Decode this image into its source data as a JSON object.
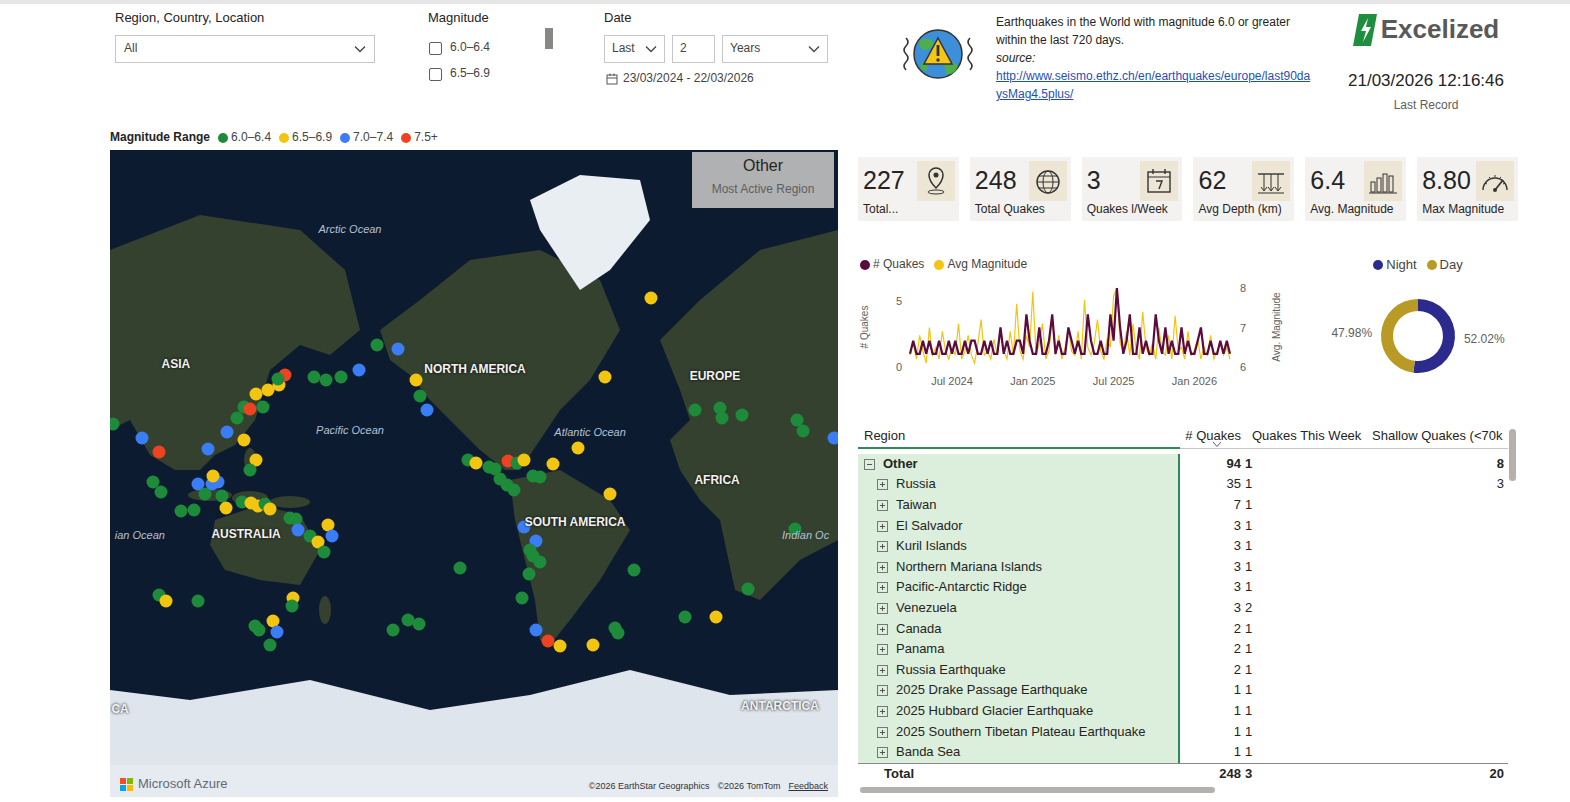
{
  "filters": {
    "region": {
      "label": "Region, Country, Location",
      "value": "All"
    },
    "magnitude": {
      "label": "Magnitude",
      "options": [
        {
          "label": "6.0–6.4",
          "checked": false
        },
        {
          "label": "6.5–6.9",
          "checked": false
        }
      ]
    },
    "date": {
      "label": "Date",
      "mode": "Last",
      "count": "2",
      "unit": "Years",
      "range": "23/03/2024 - 22/03/2026"
    }
  },
  "description": {
    "title": "Earthquakes in the World with magnitude 6.0 or greater within the last 720 days.",
    "source_label": "source:",
    "source_url": "http://www.seismo.ethz.ch/en/earthquakes/europe/last90daysMag4.5plus/"
  },
  "brand": {
    "logo": "Excelized",
    "last_record": "21/03/2026 12:16:46",
    "last_record_label": "Last Record"
  },
  "legend": {
    "title": "Magnitude Range",
    "items": [
      {
        "label": "6.0–6.4",
        "color": "#1e8b3a"
      },
      {
        "label": "6.5–6.9",
        "color": "#f2c511"
      },
      {
        "label": "7.0–7.4",
        "color": "#3b7df5"
      },
      {
        "label": "7.5+",
        "color": "#ee4322"
      }
    ]
  },
  "map": {
    "overlay": {
      "value": "Other",
      "label": "Most Active Region"
    },
    "labels": [
      {
        "text": "Arctic Ocean",
        "lon": 178.7,
        "lat": 79,
        "kind": "ocean"
      },
      {
        "text": "ASIA",
        "lon": 92.6,
        "lat": 55.3,
        "kind": "continent"
      },
      {
        "text": "Pacific Ocean",
        "lon": 178.7,
        "lat": 32.7,
        "kind": "ocean"
      },
      {
        "text": "NORTH AMERICA",
        "lon": -119.5,
        "lat": 53.9,
        "kind": "continent"
      },
      {
        "text": "Atlantic Ocean",
        "lon": -62.6,
        "lat": 31.8,
        "kind": "ocean"
      },
      {
        "text": "EUROPE",
        "lon": -0.8,
        "lat": 51.8,
        "kind": "continent"
      },
      {
        "text": "AFRICA",
        "lon": 0.2,
        "lat": 9.4,
        "kind": "continent"
      },
      {
        "text": "SOUTH AMERICA",
        "lon": -70,
        "lat": -11.3,
        "kind": "continent"
      },
      {
        "text": "AUSTRALIA",
        "lon": 127.3,
        "lat": -17.1,
        "kind": "continent"
      },
      {
        "text": "ian Ocean",
        "lon": 74.8,
        "lat": -17.1,
        "kind": "ocean"
      },
      {
        "text": "Indian Oc",
        "lon": 44,
        "lat": -17.1,
        "kind": "ocean"
      },
      {
        "text": "CA",
        "lon": 65,
        "lat": -71.4,
        "kind": "continent"
      },
      {
        "text": "ANTARCTICA",
        "lon": 31.3,
        "lat": -71,
        "kind": "continent"
      }
    ],
    "pins": [
      {
        "lon": 61.5,
        "lat": 35,
        "color": "#1e8b3a"
      },
      {
        "lon": 76,
        "lat": 29.3,
        "color": "#3b7df5"
      },
      {
        "lon": 84,
        "lat": 23,
        "color": "#ee4322"
      },
      {
        "lon": 81,
        "lat": 8.9,
        "color": "#1e8b3a"
      },
      {
        "lon": 85,
        "lat": 4,
        "color": "#1e8b3a"
      },
      {
        "lon": 95,
        "lat": -5.4,
        "color": "#1e8b3a"
      },
      {
        "lon": 101.5,
        "lat": -5,
        "color": "#1e8b3a"
      },
      {
        "lon": 103.5,
        "lat": 7.9,
        "color": "#3b7df5"
      },
      {
        "lon": 108.5,
        "lat": 24.4,
        "color": "#3b7df5"
      },
      {
        "lon": 110.4,
        "lat": 8,
        "color": "#3b7df5"
      },
      {
        "lon": 113.4,
        "lat": 8.9,
        "color": "#3b7df5"
      },
      {
        "lon": 107,
        "lat": 3,
        "color": "#1e8b3a"
      },
      {
        "lon": 111,
        "lat": 11.8,
        "color": "#f2c511"
      },
      {
        "lon": 115.4,
        "lat": 2,
        "color": "#1e8b3a"
      },
      {
        "lon": 117.4,
        "lat": -4,
        "color": "#f2c511"
      },
      {
        "lon": 125.3,
        "lat": -1,
        "color": "#1e8b3a"
      },
      {
        "lon": 129.7,
        "lat": -1.5,
        "color": "#f2c511"
      },
      {
        "lon": 133,
        "lat": -3,
        "color": "#f2c511"
      },
      {
        "lon": 136.6,
        "lat": -2,
        "color": "#1e8b3a"
      },
      {
        "lon": 139,
        "lat": -4.5,
        "color": "#f2c511"
      },
      {
        "lon": 149,
        "lat": -8.9,
        "color": "#1e8b3a"
      },
      {
        "lon": 152,
        "lat": -9.4,
        "color": "#1e8b3a"
      },
      {
        "lon": 153,
        "lat": -14.7,
        "color": "#3b7df5"
      },
      {
        "lon": 159,
        "lat": -17.6,
        "color": "#1e8b3a"
      },
      {
        "lon": 163,
        "lat": -20.3,
        "color": "#f2c511"
      },
      {
        "lon": 168,
        "lat": -12.3,
        "color": "#f2c511"
      },
      {
        "lon": 170,
        "lat": -17.6,
        "color": "#3b7df5"
      },
      {
        "lon": 166,
        "lat": -24.8,
        "color": "#1e8b3a"
      },
      {
        "lon": 126,
        "lat": 28.4,
        "color": "#f2c511"
      },
      {
        "lon": 132,
        "lat": 19.6,
        "color": "#f2c511"
      },
      {
        "lon": 129,
        "lat": 14.8,
        "color": "#1e8b3a"
      },
      {
        "lon": 118,
        "lat": 31.8,
        "color": "#3b7df5"
      },
      {
        "lon": 123,
        "lat": 37.4,
        "color": "#1e8b3a"
      },
      {
        "lon": 126,
        "lat": 41.9,
        "color": "#1e8b3a"
      },
      {
        "lon": 129,
        "lat": 40.9,
        "color": "#ee4322"
      },
      {
        "lon": 132,
        "lat": 46.5,
        "color": "#f2c511"
      },
      {
        "lon": 138,
        "lat": 47.6,
        "color": "#f2c511"
      },
      {
        "lon": 143.6,
        "lat": 49.3,
        "color": "#f2c511"
      },
      {
        "lon": 146.5,
        "lat": 52.4,
        "color": "#ee4322"
      },
      {
        "lon": 135.7,
        "lat": 41.9,
        "color": "#1e8b3a"
      },
      {
        "lon": 143,
        "lat": 51.2,
        "color": "#1e8b3a"
      },
      {
        "lon": 161,
        "lat": 51.8,
        "color": "#1e8b3a"
      },
      {
        "lon": 167,
        "lat": 50.9,
        "color": "#1e8b3a"
      },
      {
        "lon": 174,
        "lat": 51.8,
        "color": "#1e8b3a"
      },
      {
        "lon": -177,
        "lat": 53.9,
        "color": "#3b7df5"
      },
      {
        "lon": -168,
        "lat": 60.5,
        "color": "#1e8b3a"
      },
      {
        "lon": -157.6,
        "lat": 59.6,
        "color": "#3b7df5"
      },
      {
        "lon": -148.7,
        "lat": 50.9,
        "color": "#f2c511"
      },
      {
        "lon": -146.7,
        "lat": 45.8,
        "color": "#1e8b3a"
      },
      {
        "lon": -143.2,
        "lat": 40.6,
        "color": "#3b7df5"
      },
      {
        "lon": -123,
        "lat": 19.6,
        "color": "#1e8b3a"
      },
      {
        "lon": -119,
        "lat": 18,
        "color": "#f2c511"
      },
      {
        "lon": -112.6,
        "lat": 16.2,
        "color": "#1e8b3a"
      },
      {
        "lon": -109.6,
        "lat": 15.2,
        "color": "#1e8b3a"
      },
      {
        "lon": -107.1,
        "lat": 10.3,
        "color": "#1e8b3a"
      },
      {
        "lon": -103.2,
        "lat": 19.1,
        "color": "#ee4322"
      },
      {
        "lon": -98.7,
        "lat": 18,
        "color": "#1e8b3a"
      },
      {
        "lon": -95.3,
        "lat": 19.6,
        "color": "#f2c511"
      },
      {
        "lon": -90.8,
        "lat": 11.8,
        "color": "#1e8b3a"
      },
      {
        "lon": -87.4,
        "lat": 11.3,
        "color": "#1e8b3a"
      },
      {
        "lon": -81,
        "lat": 17.6,
        "color": "#f2c511"
      },
      {
        "lon": -100.2,
        "lat": 4.9,
        "color": "#1e8b3a"
      },
      {
        "lon": -103.7,
        "lat": 7.4,
        "color": "#1e8b3a"
      },
      {
        "lon": -95.3,
        "lat": -13.3,
        "color": "#3b7df5"
      },
      {
        "lon": -89.3,
        "lat": -19.9,
        "color": "#3b7df5"
      },
      {
        "lon": -92.3,
        "lat": -23.9,
        "color": "#1e8b3a"
      },
      {
        "lon": -90.8,
        "lat": -26.7,
        "color": "#1e8b3a"
      },
      {
        "lon": -87.4,
        "lat": -29.3,
        "color": "#1e8b3a"
      },
      {
        "lon": -92.8,
        "lat": -34.3,
        "color": "#1e8b3a"
      },
      {
        "lon": -96.3,
        "lat": -43.4,
        "color": "#1e8b3a"
      },
      {
        "lon": -89.3,
        "lat": -53.9,
        "color": "#3b7df5"
      },
      {
        "lon": -83.4,
        "lat": -57,
        "color": "#ee4322"
      },
      {
        "lon": -77.5,
        "lat": -58.3,
        "color": "#f2c511"
      },
      {
        "lon": -61.2,
        "lat": -58,
        "color": "#f2c511"
      },
      {
        "lon": -50.3,
        "lat": -53.3,
        "color": "#1e8b3a"
      },
      {
        "lon": -48.8,
        "lat": -54.8,
        "color": "#1e8b3a"
      },
      {
        "lon": -40.9,
        "lat": -32.7,
        "color": "#1e8b3a"
      },
      {
        "lon": -127,
        "lat": -31.8,
        "color": "#1e8b3a"
      },
      {
        "lon": -68.6,
        "lat": 24.8,
        "color": "#f2c511"
      },
      {
        "lon": -52.7,
        "lat": 3,
        "color": "#f2c511"
      },
      {
        "lon": -55.2,
        "lat": 51.8,
        "color": "#f2c511"
      },
      {
        "lon": -32.5,
        "lat": 70.2,
        "color": "#f2c511"
      },
      {
        "lon": -15.7,
        "lat": -49.9,
        "color": "#1e8b3a"
      },
      {
        "lon": -0.3,
        "lat": -50,
        "color": "#f2c511"
      },
      {
        "lon": 15.5,
        "lat": -40.1,
        "color": "#1e8b3a"
      },
      {
        "lon": 84.2,
        "lat": -42.3,
        "color": "#1e8b3a"
      },
      {
        "lon": 87.7,
        "lat": -44.5,
        "color": "#f2c511"
      },
      {
        "lon": 103.5,
        "lat": -44.5,
        "color": "#1e8b3a"
      },
      {
        "lon": 131.7,
        "lat": -52.7,
        "color": "#1e8b3a"
      },
      {
        "lon": 133.7,
        "lat": -53.9,
        "color": "#1e8b3a"
      },
      {
        "lon": 140.6,
        "lat": -51.2,
        "color": "#f2c511"
      },
      {
        "lon": 142.6,
        "lat": -54.5,
        "color": "#3b7df5"
      },
      {
        "lon": 139.1,
        "lat": -58,
        "color": "#1e8b3a"
      },
      {
        "lon": 150.5,
        "lat": -43.4,
        "color": "#f2c511"
      },
      {
        "lon": 150,
        "lat": -46.2,
        "color": "#1e8b3a"
      },
      {
        "lon": -160,
        "lat": -53.9,
        "color": "#1e8b3a"
      },
      {
        "lon": -152.6,
        "lat": -50.9,
        "color": "#1e8b3a"
      },
      {
        "lon": -147.2,
        "lat": -52.2,
        "color": "#1e8b3a"
      },
      {
        "lon": -10.7,
        "lat": 40.6,
        "color": "#1e8b3a"
      },
      {
        "lon": 1.6,
        "lat": 41.3,
        "color": "#1e8b3a"
      },
      {
        "lon": 2.6,
        "lat": 37.4,
        "color": "#1e8b3a"
      },
      {
        "lon": 12.5,
        "lat": 38.6,
        "color": "#1e8b3a"
      },
      {
        "lon": 39.7,
        "lat": 36.7,
        "color": "#1e8b3a"
      },
      {
        "lon": 42.7,
        "lat": 32.3,
        "color": "#1e8b3a"
      },
      {
        "lon": 58,
        "lat": 29.3,
        "color": "#3b7df5"
      },
      {
        "lon": 38.7,
        "lat": -14.2,
        "color": "#1e8b3a"
      }
    ],
    "attribution": {
      "brand": "Microsoft Azure",
      "credits": [
        "©2026 EarthStar Geographics",
        "©2026 TomTom"
      ],
      "feedback": "Feedback"
    }
  },
  "kpis": [
    {
      "value": "227",
      "label": "Total..."
    },
    {
      "value": "248",
      "label": "Total Quakes"
    },
    {
      "value": "3",
      "label": "Quakes l/Week"
    },
    {
      "value": "62",
      "label": "Avg Depth (km)"
    },
    {
      "value": "6.4",
      "label": "Avg. Magnitude"
    },
    {
      "value": "8.80",
      "label": "Max Magnitude"
    }
  ],
  "trend": {
    "series": [
      {
        "label": "# Quakes",
        "color": "#5c0b3f",
        "axis": "left",
        "values": [
          1,
          2,
          1,
          1,
          2,
          1,
          2,
          1,
          1,
          2,
          1,
          1,
          2,
          1,
          2,
          1,
          1,
          2,
          1,
          2,
          2,
          1,
          1,
          2,
          1,
          2,
          1,
          1,
          3,
          1,
          2,
          1,
          1,
          2,
          2,
          1,
          4,
          2,
          1,
          1,
          3,
          1,
          1,
          2,
          4,
          1,
          2,
          1,
          1,
          3,
          2,
          1,
          2,
          1,
          1,
          4,
          2,
          1,
          1,
          2,
          1,
          1,
          4,
          2,
          6,
          3,
          1,
          2,
          4,
          1,
          1,
          3,
          1,
          2,
          1,
          1,
          4,
          2,
          1,
          3,
          1,
          2,
          1,
          1,
          3,
          1,
          2,
          1,
          1,
          2,
          3,
          1,
          1,
          2,
          1,
          1,
          2,
          1,
          2,
          1
        ]
      },
      {
        "label": "Avg Magnitude",
        "color": "#f2c511",
        "axis": "right",
        "values": [
          6.3,
          6.6,
          6.2,
          6.8,
          6.4,
          6.1,
          7.0,
          6.3,
          6.5,
          6.2,
          6.9,
          6.4,
          6.2,
          6.5,
          6.3,
          7.1,
          6.2,
          6.4,
          6.8,
          6.3,
          6.1,
          6.6,
          7.2,
          6.3,
          6.4,
          6.2,
          6.7,
          6.3,
          7.0,
          6.4,
          6.2,
          6.9,
          6.3,
          7.6,
          6.4,
          6.2,
          6.8,
          6.5,
          7.9,
          6.3,
          6.6,
          7.1,
          6.2,
          6.4,
          7.3,
          6.3,
          6.8,
          6.2,
          6.5,
          7.0,
          6.4,
          6.3,
          6.9,
          6.2,
          7.7,
          6.5,
          6.3,
          6.6,
          7.2,
          6.4,
          6.2,
          6.7,
          6.5,
          7.8,
          8.0,
          6.6,
          6.4,
          6.9,
          6.3,
          7.1,
          6.4,
          6.2,
          7.4,
          6.5,
          6.3,
          6.6,
          6.2,
          7.0,
          6.4,
          6.3,
          6.8,
          6.2,
          7.3,
          6.4,
          6.5,
          6.2,
          6.9,
          6.3,
          6.4,
          6.7,
          6.2,
          6.5,
          6.3,
          6.8,
          6.2,
          6.4,
          6.6,
          6.3,
          6.5,
          6.2
        ]
      }
    ],
    "left_axis": {
      "title": "# Quakes",
      "min": 0,
      "max": 6,
      "ticks": [
        {
          "label": "5",
          "value": 5
        },
        {
          "label": "0",
          "value": 0
        }
      ]
    },
    "right_axis": {
      "title": "Avg. Magnitude",
      "min": 6,
      "max": 8,
      "ticks": [
        {
          "label": "8",
          "value": 8
        },
        {
          "label": "7",
          "value": 7
        },
        {
          "label": "6",
          "value": 6
        }
      ]
    },
    "x_ticks": [
      {
        "label": "Jul 2024",
        "index": 13
      },
      {
        "label": "Jan 2025",
        "index": 38
      },
      {
        "label": "Jul 2025",
        "index": 63
      },
      {
        "label": "Jan 2026",
        "index": 88
      }
    ]
  },
  "day_night": {
    "slices": [
      {
        "label": "Night",
        "share": 0.5202,
        "reading": "52.02%",
        "color": "#2c2a8c"
      },
      {
        "label": "Day",
        "share": 0.4798,
        "reading": "47.98%",
        "color": "#b89a24"
      }
    ]
  },
  "table": {
    "columns": [
      {
        "label": "Region",
        "sorted": false
      },
      {
        "label": "# Quakes",
        "sorted": true
      },
      {
        "label": "Quakes This Week",
        "sorted": false
      },
      {
        "label": "Shallow Quakes (<70k",
        "sorted": false
      }
    ],
    "rows": [
      {
        "cells": [
          "Other",
          "94",
          "1",
          "8"
        ],
        "depth": 0,
        "expanded": true
      },
      {
        "cells": [
          "Russia",
          "35",
          "1",
          "3"
        ],
        "depth": 1,
        "expanded": false
      },
      {
        "cells": [
          "Taiwan",
          "7",
          "1"
        ],
        "depth": 1,
        "expanded": false
      },
      {
        "cells": [
          "El Salvador",
          "3",
          "1"
        ],
        "depth": 1,
        "expanded": false
      },
      {
        "cells": [
          "Kuril Islands",
          "3",
          "1"
        ],
        "depth": 1,
        "expanded": false
      },
      {
        "cells": [
          "Northern Mariana Islands",
          "3",
          "1"
        ],
        "depth": 1,
        "expanded": false
      },
      {
        "cells": [
          "Pacific-Antarctic Ridge",
          "3",
          "1"
        ],
        "depth": 1,
        "expanded": false
      },
      {
        "cells": [
          "Venezuela",
          "3",
          "2"
        ],
        "depth": 1,
        "expanded": false
      },
      {
        "cells": [
          "Canada",
          "2",
          "1"
        ],
        "depth": 1,
        "expanded": false
      },
      {
        "cells": [
          "Panama",
          "2",
          "1"
        ],
        "depth": 1,
        "expanded": false
      },
      {
        "cells": [
          "Russia Earthquake",
          "2",
          "1"
        ],
        "depth": 1,
        "expanded": false
      },
      {
        "cells": [
          "2025 Drake Passage Earthquake",
          "1",
          "1"
        ],
        "depth": 1,
        "expanded": false
      },
      {
        "cells": [
          "2025 Hubbard Glacier Earthquake",
          "1",
          "1"
        ],
        "depth": 1,
        "expanded": false
      },
      {
        "cells": [
          "2025 Southern Tibetan Plateau Earthquake",
          "1",
          "1"
        ],
        "depth": 1,
        "expanded": false
      },
      {
        "cells": [
          "Banda Sea",
          "1",
          "1"
        ],
        "depth": 1,
        "expanded": false
      }
    ],
    "total": [
      "Total",
      "248",
      "3",
      "20"
    ]
  }
}
